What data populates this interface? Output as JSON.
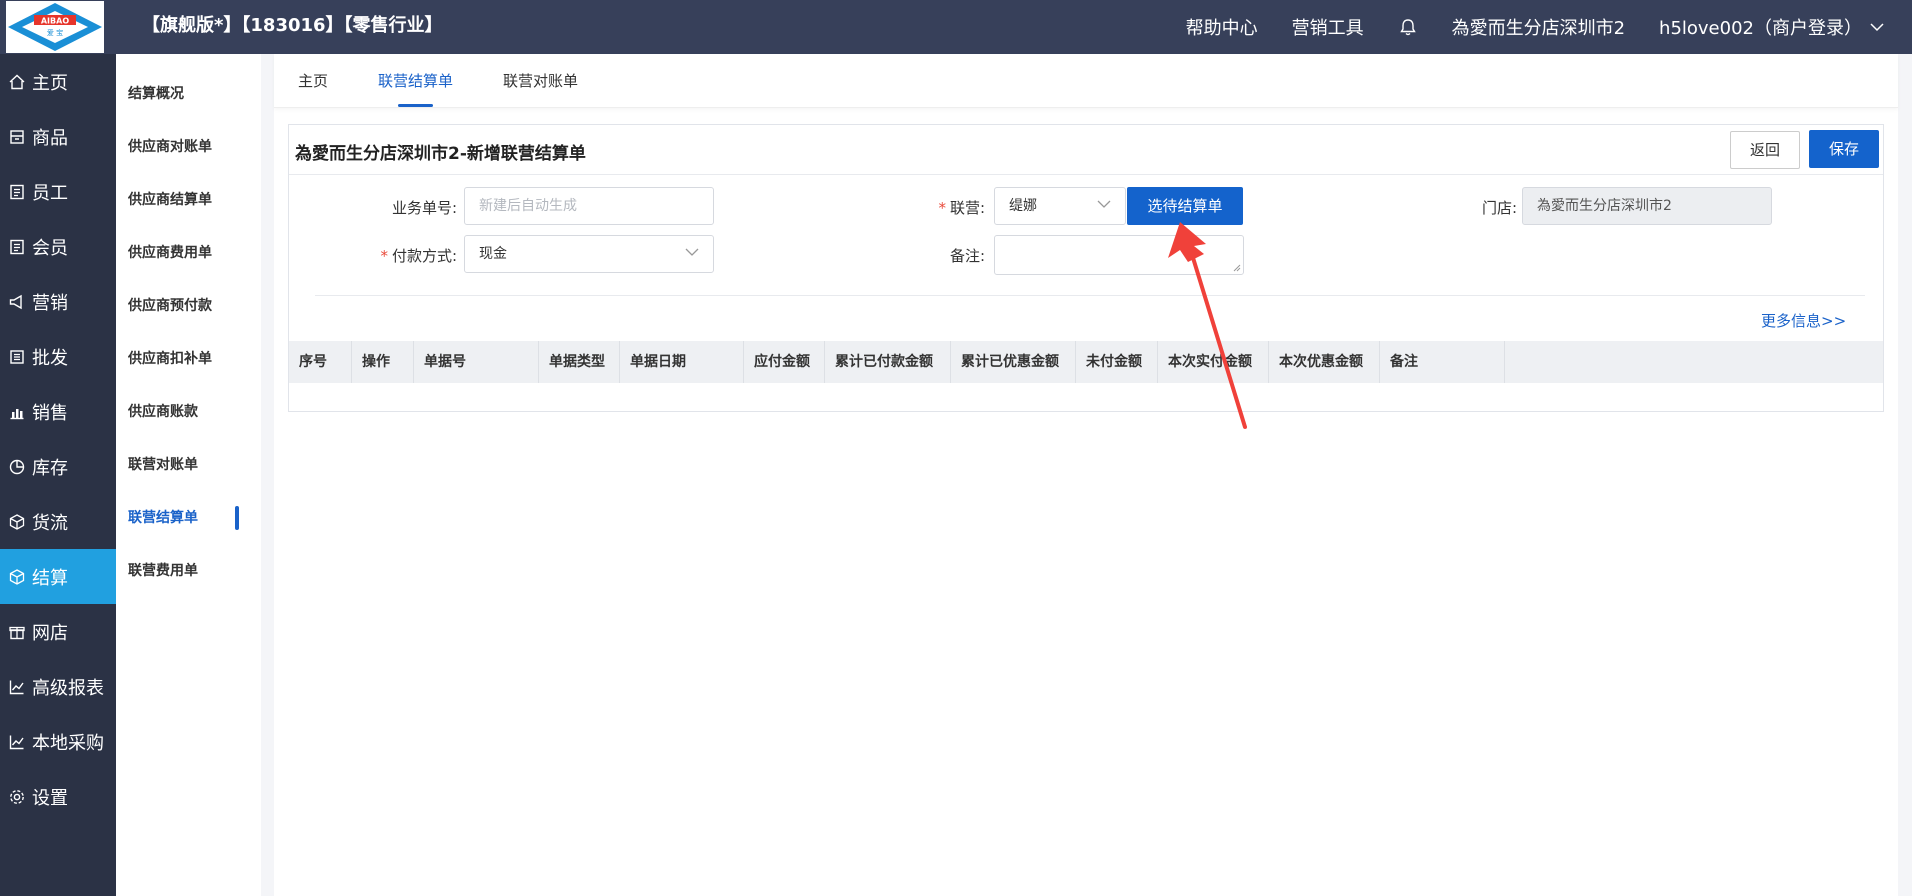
{
  "header": {
    "logo_text": "AIBAO",
    "logo_sub": "爱 宝",
    "app_meta": "【旗舰版*】【183016】【零售行业】",
    "help": "帮助中心",
    "marketing_tools": "营销工具",
    "store_name": "為愛而生分店深圳市2",
    "user": "h5love002（商户登录）"
  },
  "mainnav": [
    {
      "label": "主页",
      "icon": "home-icon"
    },
    {
      "label": "商品",
      "icon": "goods-icon"
    },
    {
      "label": "员工",
      "icon": "staff-icon"
    },
    {
      "label": "会员",
      "icon": "member-icon"
    },
    {
      "label": "营销",
      "icon": "megaphone-icon"
    },
    {
      "label": "批发",
      "icon": "list-icon"
    },
    {
      "label": "销售",
      "icon": "bar-chart-icon"
    },
    {
      "label": "库存",
      "icon": "pie-icon"
    },
    {
      "label": "货流",
      "icon": "cube-icon"
    },
    {
      "label": "结算",
      "icon": "cube-icon"
    },
    {
      "label": "网店",
      "icon": "gift-icon"
    },
    {
      "label": "高级报表",
      "icon": "line-chart-icon"
    },
    {
      "label": "本地采购",
      "icon": "line-chart-icon"
    },
    {
      "label": "设置",
      "icon": "gear-icon"
    }
  ],
  "subnav": [
    "结算概况",
    "供应商对账单",
    "供应商结算单",
    "供应商费用单",
    "供应商预付款",
    "供应商扣补单",
    "供应商账款",
    "联营对账单",
    "联营结算单",
    "联营费用单"
  ],
  "tabs": [
    "主页",
    "联营结算单",
    "联营对账单"
  ],
  "panel": {
    "title": "為愛而生分店深圳市2-新增联营结算单",
    "back": "返回",
    "save": "保存"
  },
  "form": {
    "biz_no_label": "业务单号:",
    "biz_no_placeholder": "新建后自动生成",
    "joint_label": "联营:",
    "joint_value": "缇娜",
    "select_btn": "选待结算单",
    "store_label": "门店:",
    "store_value": "為愛而生分店深圳市2",
    "pay_label": "付款方式:",
    "pay_value": "现金",
    "remark_label": "备注:",
    "req_mark": "*",
    "more": "更多信息>>"
  },
  "table": {
    "columns": [
      "序号",
      "操作",
      "单据号",
      "单据类型",
      "单据日期",
      "应付金额",
      "累计已付款金额",
      "累计已优惠金额",
      "未付金额",
      "本次实付金额",
      "本次优惠金额",
      "备注"
    ]
  },
  "colors": {
    "topbar": "#37405a",
    "nav": "#2b3245",
    "active_nav": "#21a0e0",
    "primary": "#1463cc",
    "arrow": "#f0413a"
  }
}
